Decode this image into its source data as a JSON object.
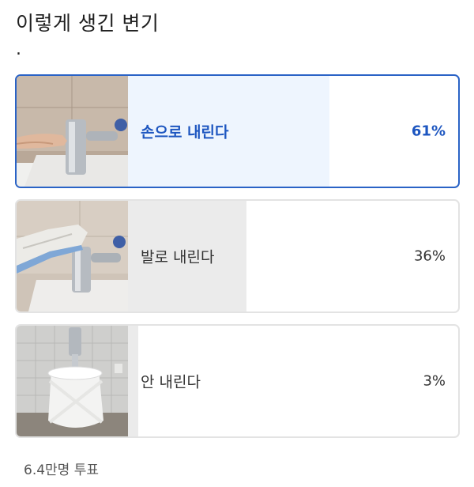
{
  "post": {
    "title": "이렇게 생긴 변기",
    "body": "."
  },
  "poll": {
    "options": [
      {
        "label": "손으로 내린다",
        "percent_text": "61%",
        "percent": 61,
        "selected": true,
        "image": "toilet-flush-by-hand-photo"
      },
      {
        "label": "발로 내린다",
        "percent_text": "36%",
        "percent": 36,
        "selected": false,
        "image": "toilet-flush-by-foot-photo"
      },
      {
        "label": "안 내린다",
        "percent_text": "3%",
        "percent": 3,
        "selected": false,
        "image": "toilet-tied-photo"
      }
    ],
    "vote_count": "6.4만명 투표"
  },
  "colors": {
    "accent": "#2a63c6",
    "selected_fill": "#eef5fe",
    "result_fill": "#ebebeb",
    "border": "#e3e3e3"
  }
}
